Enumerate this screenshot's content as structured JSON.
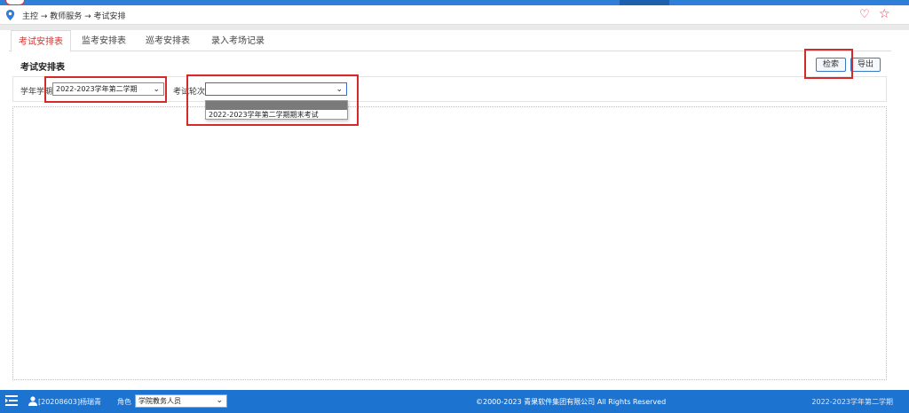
{
  "breadcrumb": {
    "text": "主控 → 教师服务 → 考试安排"
  },
  "tabs": [
    {
      "label": "考试安排表",
      "active": true
    },
    {
      "label": "监考安排表",
      "active": false
    },
    {
      "label": "巡考安排表",
      "active": false
    },
    {
      "label": "录入考场记录",
      "active": false
    }
  ],
  "section": {
    "title": "考试安排表"
  },
  "toolbar": {
    "search_label": "检索",
    "export_label": "导出"
  },
  "filters": {
    "term_label": "学年学期",
    "term_value": "2022-2023学年第二学期",
    "round_label": "考试轮次",
    "round_value": ""
  },
  "round_dropdown": {
    "options": [
      "",
      "2022-2023学年第二学期期末考试"
    ]
  },
  "footer": {
    "user": "[20208603]杨瑞青",
    "role_label": "角色",
    "role_value": "学院教务人员",
    "copyright": "©2000-2023 青果软件集团有限公司 All Rights Reserved",
    "term": "2022-2023学年第二学期"
  },
  "colors": {
    "primary": "#1d74d0",
    "accent_red": "#d8312b",
    "highlight_box": "#d62a2a"
  },
  "icons": {
    "location": "location-pin-icon",
    "favorite": "heart-icon",
    "bookmark": "star-icon",
    "menu": "menu-toggle-icon",
    "user": "user-icon"
  }
}
